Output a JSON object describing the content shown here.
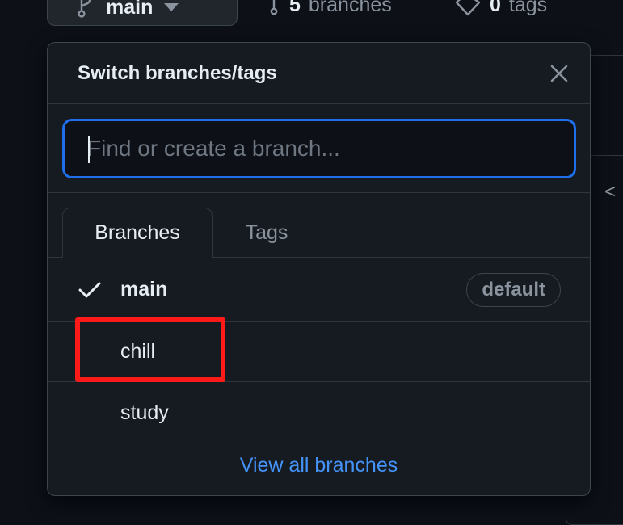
{
  "topbar": {
    "current_branch": "main",
    "branches_count": "5",
    "branches_label": "branches",
    "tags_count": "0",
    "tags_label": "tags"
  },
  "dropdown": {
    "title": "Switch branches/tags",
    "search": {
      "placeholder": "Find or create a branch...",
      "value": ""
    },
    "tabs": [
      {
        "label": "Branches",
        "active": true
      },
      {
        "label": "Tags",
        "active": false
      }
    ],
    "branches": [
      {
        "name": "main",
        "selected": true,
        "badge": "default"
      },
      {
        "name": "chill",
        "selected": false,
        "highlighted": true
      },
      {
        "name": "study",
        "selected": false
      }
    ],
    "footer_link": "View all branches"
  },
  "background": {
    "chevron": "<"
  },
  "colors": {
    "accent_link": "#4493f8",
    "focus_ring": "#1f6feb",
    "highlight": "#ff1a1a"
  }
}
